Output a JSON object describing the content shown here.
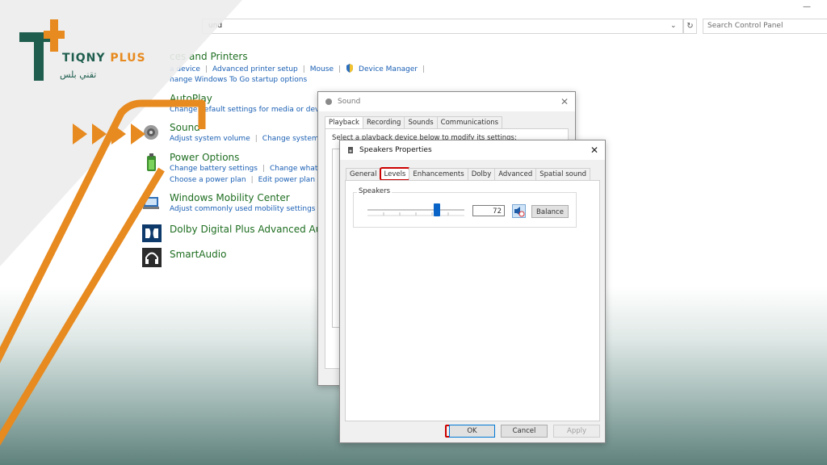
{
  "control_panel": {
    "address_text": "und",
    "search_placeholder": "Search Control Panel",
    "minimize": "—",
    "refresh": "↻",
    "dropdown": "⌄",
    "categories": [
      {
        "title": "ces and Printers",
        "links": [
          "a device",
          "Advanced printer setup",
          "Mouse",
          "Device Manager"
        ],
        "sub": "hange Windows To Go startup options"
      },
      {
        "title": "AutoPlay",
        "links": [
          "Change default settings for media or device"
        ]
      },
      {
        "title": "Sound",
        "links": [
          "Adjust system volume",
          "Change system s"
        ]
      },
      {
        "title": "Power Options",
        "links": [
          "Change battery settings",
          "Change what th"
        ],
        "sub_links": [
          "Choose a power plan",
          "Edit power plan"
        ]
      },
      {
        "title": "Windows Mobility Center",
        "links": [
          "Adjust commonly used mobility settings"
        ]
      },
      {
        "title": "Dolby Digital Plus Advanced Audi",
        "links": []
      },
      {
        "title": "SmartAudio",
        "links": []
      }
    ]
  },
  "brand": {
    "name_main": "TIQNY",
    "name_plus": "PLUS",
    "arabic": "تقني بلس",
    "colors": {
      "green": "#1f5e4e",
      "orange": "#e78a1f"
    }
  },
  "sound_dialog": {
    "title": "Sound",
    "tabs": [
      "Playback",
      "Recording",
      "Sounds",
      "Communications"
    ],
    "active_tab": "Playback",
    "partial_text": "Select a playback device below to modify its settings:"
  },
  "speakers_dialog": {
    "title": "Speakers Properties",
    "tabs": [
      "General",
      "Levels",
      "Enhancements",
      "Dolby",
      "Advanced",
      "Spatial sound"
    ],
    "active_tab": "Levels",
    "group_label": "Speakers",
    "volume_value": "72",
    "volume_level": 0.72,
    "balance_label": "Balance",
    "ok_label": "OK",
    "cancel_label": "Cancel",
    "apply_label": "Apply",
    "highlight_color": "#cc0000"
  }
}
